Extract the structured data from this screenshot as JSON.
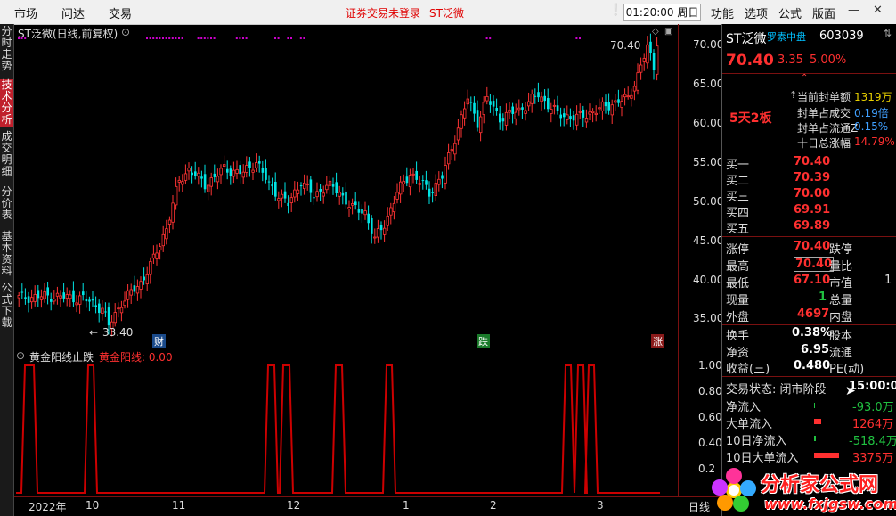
{
  "topbar": {
    "menus": [
      "市场",
      "问达",
      "交易"
    ],
    "notice": "证券交易未登录",
    "stock_short": "ST泛微",
    "clock": "01:20:00 周日",
    "right_menus": [
      "功能",
      "选项",
      "公式",
      "版面"
    ]
  },
  "left_tabs": [
    "分时走势",
    "技术分析",
    "成交明细",
    "分价表",
    "基本资料",
    "公式下载"
  ],
  "main_chart": {
    "title": "ST泛微(日线,前复权)",
    "y_ticks": [
      "70.00",
      "65.00",
      "60.00",
      "55.00",
      "50.00",
      "45.00",
      "40.00",
      "35.00"
    ],
    "high_label": "70.40",
    "low_label": "33.40",
    "event_labels": [
      "财",
      "跌",
      "涨"
    ]
  },
  "indicator": {
    "title": "黄金阳线止跌",
    "series_label": "黄金阳线: 0.00",
    "y_ticks": [
      "1.00",
      "0.80",
      "0.60",
      "0.40",
      "0.2"
    ]
  },
  "x_axis": {
    "labels": [
      "2022年",
      "10",
      "11",
      "12",
      "1",
      "2",
      "3"
    ],
    "right_label": "日线"
  },
  "quote": {
    "name": "ST泛微",
    "tag": "罗素中盘",
    "code": "603039",
    "price": "70.40",
    "change": "3.35",
    "pct": "5.00%",
    "board_label": "5天2板",
    "seal": [
      {
        "label": "当前封单额",
        "value": "1319万"
      },
      {
        "label": "封单占成交",
        "value": "0.19倍"
      },
      {
        "label": "封单占流通Z",
        "value": "0.15%"
      },
      {
        "label": "十日总涨幅",
        "value": "14.79%"
      }
    ],
    "bids": [
      {
        "label": "买一",
        "value": "70.40"
      },
      {
        "label": "买二",
        "value": "70.39"
      },
      {
        "label": "买三",
        "value": "70.00"
      },
      {
        "label": "买四",
        "value": "69.91"
      },
      {
        "label": "买五",
        "value": "69.89"
      }
    ],
    "stats": [
      {
        "label": "涨停",
        "value": "70.40",
        "label2": "跌停"
      },
      {
        "label": "最高",
        "value": "70.40",
        "label2": "量比"
      },
      {
        "label": "最低",
        "value": "67.10",
        "label2": "市值",
        "v2": "1"
      },
      {
        "label": "现量",
        "value": "1",
        "label2": "总量"
      },
      {
        "label": "外盘",
        "value": "4697",
        "label2": "内盘"
      }
    ],
    "stats2": [
      {
        "label": "换手",
        "value": "0.38%",
        "label2": "股本"
      },
      {
        "label": "净资",
        "value": "6.95",
        "label2": "流通"
      },
      {
        "label": "收益(三)",
        "value": "0.480",
        "label2": "PE(动)"
      }
    ],
    "trade_state_label": "交易状态: 闭市阶段",
    "trade_state_time": "15:00:0",
    "flows": [
      {
        "label": "净流入",
        "value": "-93.0万"
      },
      {
        "label": "大单流入",
        "value": "1264万"
      },
      {
        "label": "10日净流入",
        "value": "-518.4万"
      },
      {
        "label": "10日大单流入",
        "value": "3375万"
      }
    ]
  },
  "watermark": {
    "title": "分析家公式网",
    "url": "www.fxjgsw.com"
  },
  "colors": {
    "up": "#ff3333",
    "down": "#00e5e5",
    "signal": "#cc0000",
    "purple": "#cc00cc"
  }
}
